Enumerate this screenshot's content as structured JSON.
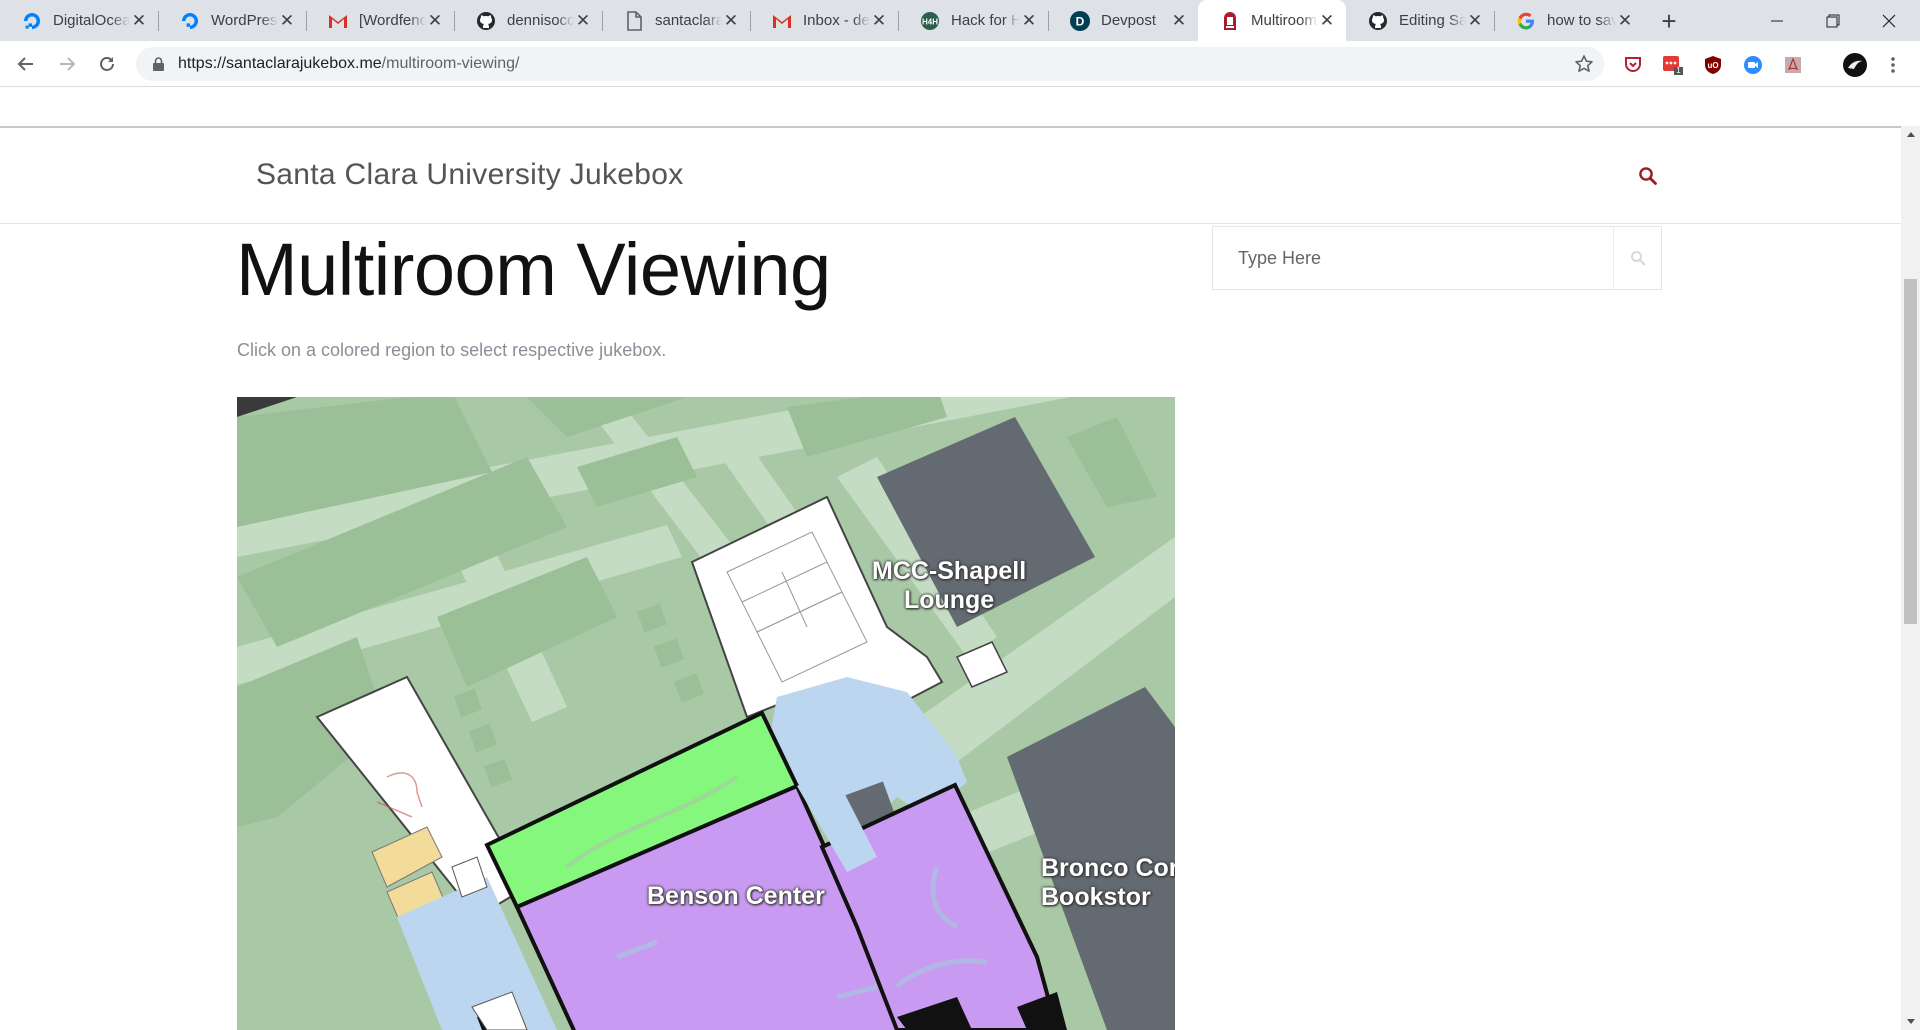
{
  "browser": {
    "tabs": [
      {
        "title": "DigitalOcean",
        "icon": "digitalocean-icon"
      },
      {
        "title": "WordPress",
        "icon": "digitalocean-icon"
      },
      {
        "title": "[Wordfence]",
        "icon": "gmail-icon"
      },
      {
        "title": "dennisocon",
        "icon": "github-icon"
      },
      {
        "title": "santaclarajukebox",
        "icon": "document-icon"
      },
      {
        "title": "Inbox - dennis",
        "icon": "gmail-icon"
      },
      {
        "title": "Hack for Humanity",
        "icon": "hack-icon"
      },
      {
        "title": "Devpost",
        "icon": "devpost-icon"
      },
      {
        "title": "Multiroom Viewing",
        "icon": "jukebox-icon",
        "active": true
      },
      {
        "title": "Editing Santa",
        "icon": "github-icon"
      },
      {
        "title": "how to save",
        "icon": "google-icon"
      }
    ],
    "url_host": "https://santaclarajukebox.me",
    "url_path": "/multiroom-viewing/",
    "extension_badge": "1"
  },
  "site": {
    "title": "Santa Clara University Jukebox"
  },
  "page": {
    "title": "Multiroom Viewing",
    "lead": "Click on a colored region to select respective jukebox."
  },
  "sidebar": {
    "search_placeholder": "Type Here"
  },
  "map": {
    "labels": {
      "mcc": "MCC-Shapell\nLounge",
      "benson": "Benson Center",
      "bronco": "Bronco Cor\nBookstor"
    },
    "colors": {
      "grass": "#a9c8a5",
      "field": "#9bbf96",
      "path": "#c5dcc4",
      "building_gray": "#646a72",
      "interior_blue": "#bcd6f0",
      "purple_zone": "#c99af2",
      "green_zone": "#86f77d",
      "tan_zone": "#f3dc9a"
    }
  }
}
